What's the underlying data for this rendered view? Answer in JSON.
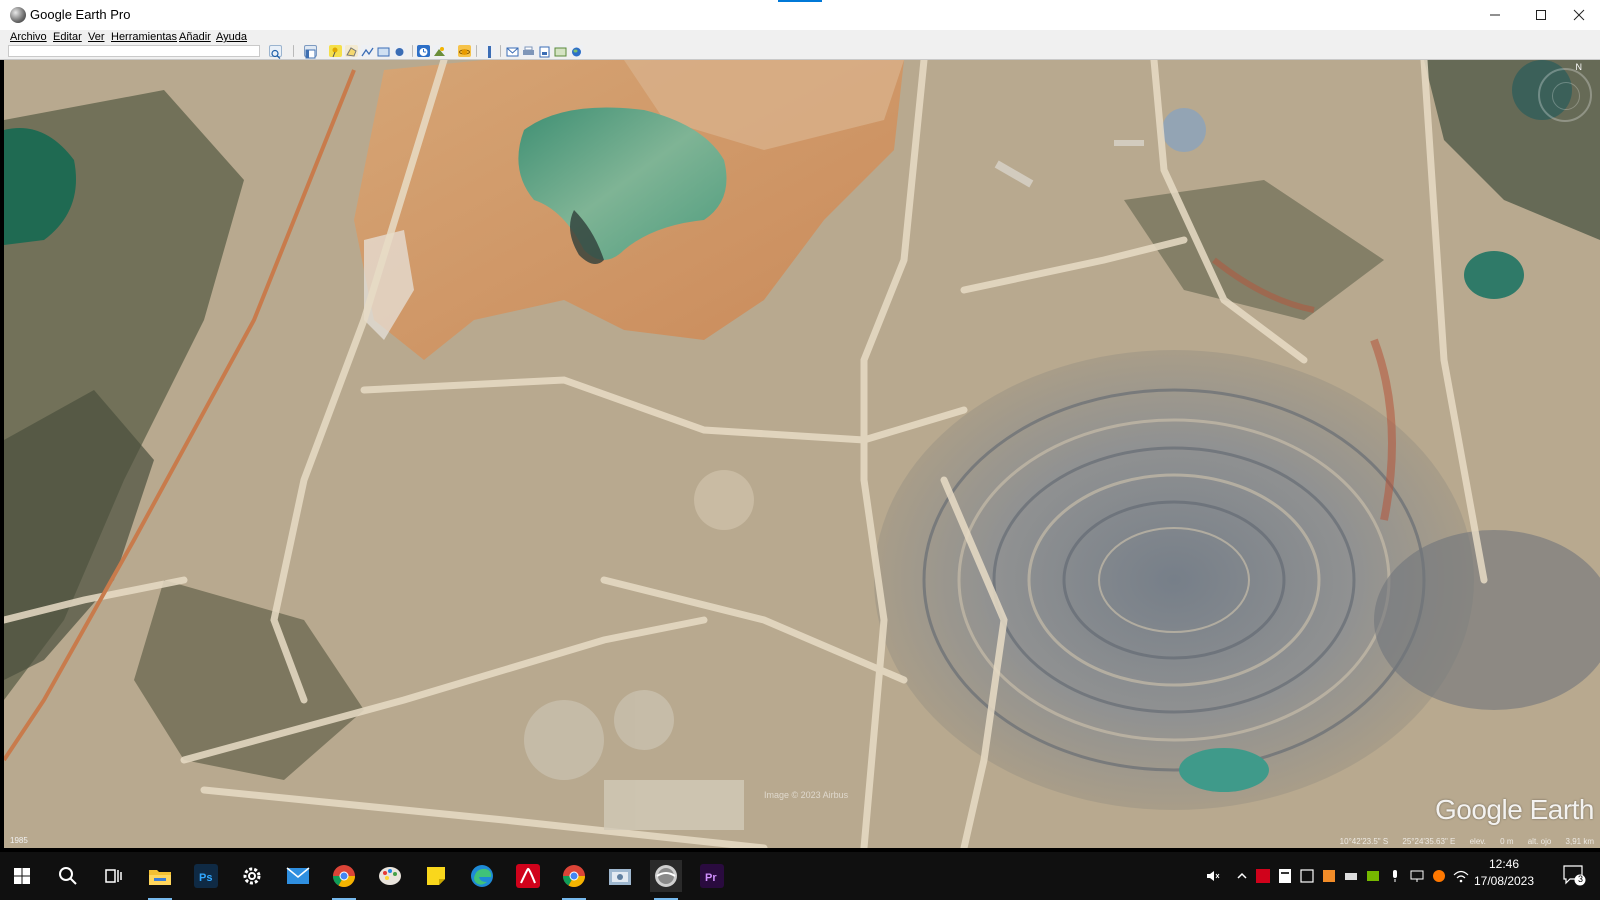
{
  "window": {
    "title": "Google Earth Pro",
    "icon": "google-earth-icon",
    "controls": [
      "minimize",
      "maximize",
      "close"
    ]
  },
  "menu": [
    "Archivo",
    "Editar",
    "Ver",
    "Herramientas",
    "Añadir",
    "Ayuda"
  ],
  "toolbar": {
    "buttons": [
      "search",
      "sidebar-toggle",
      "add-placemark",
      "add-polygon",
      "add-path",
      "add-image-overlay",
      "record-tour",
      "historical-imagery",
      "sun",
      "planets",
      "ruler",
      "email",
      "print",
      "save-image",
      "view-in-maps"
    ]
  },
  "map": {
    "imagery_year": "1985",
    "credit": "Image © 2023 Airbus",
    "brand": "Google Earth",
    "status": {
      "lat": "10°42'23.5\" S",
      "lon": "25°24'35.63\" E",
      "elev": "elev.",
      "elev_value": "0 m",
      "eye_label": "alt. ojo",
      "eye_value": "3,91 km"
    }
  },
  "taskbar": {
    "apps": [
      "start",
      "search",
      "task-view",
      "file-explorer",
      "photoshop",
      "settings",
      "mail",
      "chrome",
      "paint",
      "sticky-notes",
      "edge",
      "acrobat",
      "chrome",
      "snip",
      "google-earth",
      "premiere"
    ],
    "clock_time": "12:46",
    "clock_date": "17/08/2023",
    "notifications": "3"
  },
  "colors": {
    "taskbar_bg": "#101010",
    "accent": "#0078d7",
    "active_underline": "#76b9ed"
  }
}
